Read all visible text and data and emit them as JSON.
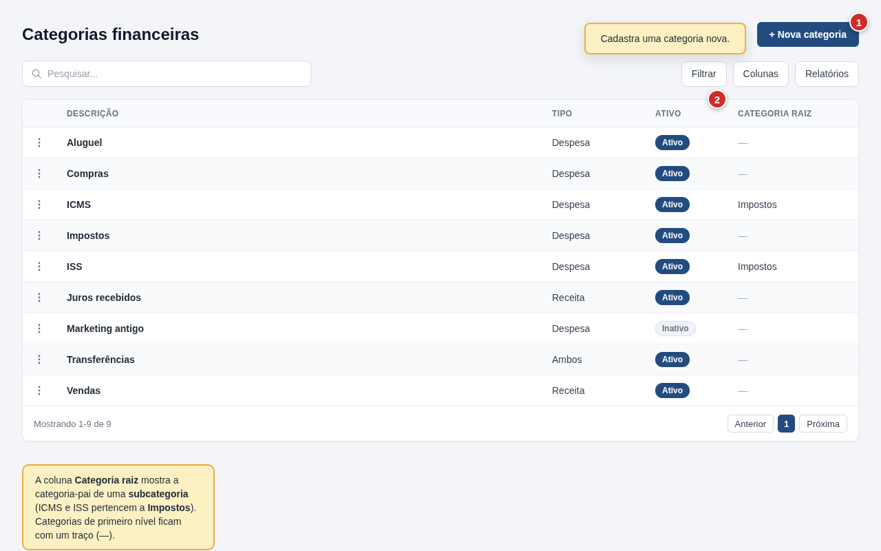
{
  "page": {
    "title": "Categorias financeiras"
  },
  "primary_action": {
    "label": "+ Nova categoria"
  },
  "tooltip": {
    "text": "Cadastra uma categoria nova."
  },
  "markers": [
    {
      "label": "1"
    },
    {
      "label": "2"
    }
  ],
  "search": {
    "placeholder": "Pesquisar..."
  },
  "toolbar_buttons": [
    "Filtrar",
    "Colunas",
    "Relatórios"
  ],
  "table": {
    "columns": [
      "DESCRIÇÃO",
      "TIPO",
      "ATIVO",
      "CATEGORIA RAIZ"
    ],
    "rows": [
      {
        "description": "Aluguel",
        "type": "Despesa",
        "status": {
          "label": "Ativo",
          "active": true
        },
        "root_category": {
          "text": "—",
          "muted": true
        }
      },
      {
        "description": "Compras",
        "type": "Despesa",
        "status": {
          "label": "Ativo",
          "active": true
        },
        "root_category": {
          "text": "—",
          "muted": true
        }
      },
      {
        "description": "ICMS",
        "type": "Despesa",
        "status": {
          "label": "Ativo",
          "active": true
        },
        "root_category": {
          "text": "Impostos",
          "muted": false
        }
      },
      {
        "description": "Impostos",
        "type": "Despesa",
        "status": {
          "label": "Ativo",
          "active": true
        },
        "root_category": {
          "text": "—",
          "muted": true
        }
      },
      {
        "description": "ISS",
        "type": "Despesa",
        "status": {
          "label": "Ativo",
          "active": true
        },
        "root_category": {
          "text": "Impostos",
          "muted": false
        }
      },
      {
        "description": "Juros recebidos",
        "type": "Receita",
        "status": {
          "label": "Ativo",
          "active": true
        },
        "root_category": {
          "text": "—",
          "muted": true
        }
      },
      {
        "description": "Marketing antigo",
        "type": "Despesa",
        "status": {
          "label": "Inativo",
          "active": false
        },
        "root_category": {
          "text": "—",
          "muted": true
        }
      },
      {
        "description": "Transferências",
        "type": "Ambos",
        "status": {
          "label": "Ativo",
          "active": true
        },
        "root_category": {
          "text": "—",
          "muted": true
        }
      },
      {
        "description": "Vendas",
        "type": "Receita",
        "status": {
          "label": "Ativo",
          "active": true
        },
        "root_category": {
          "text": "—",
          "muted": true
        }
      }
    ]
  },
  "footer": {
    "summary": "Mostrando 1-9 de 9",
    "pagination": {
      "previous": "Anterior",
      "pages": [
        {
          "label": "1",
          "selected": true
        }
      ],
      "next": "Próxima"
    }
  },
  "note": {
    "text": "A coluna **Categoria raiz** mostra a categoria-pai de uma **subcategoria** (ICMS e ISS pertencem a **Impostos**). Categorias de primeiro nível ficam com um traço (—)."
  }
}
